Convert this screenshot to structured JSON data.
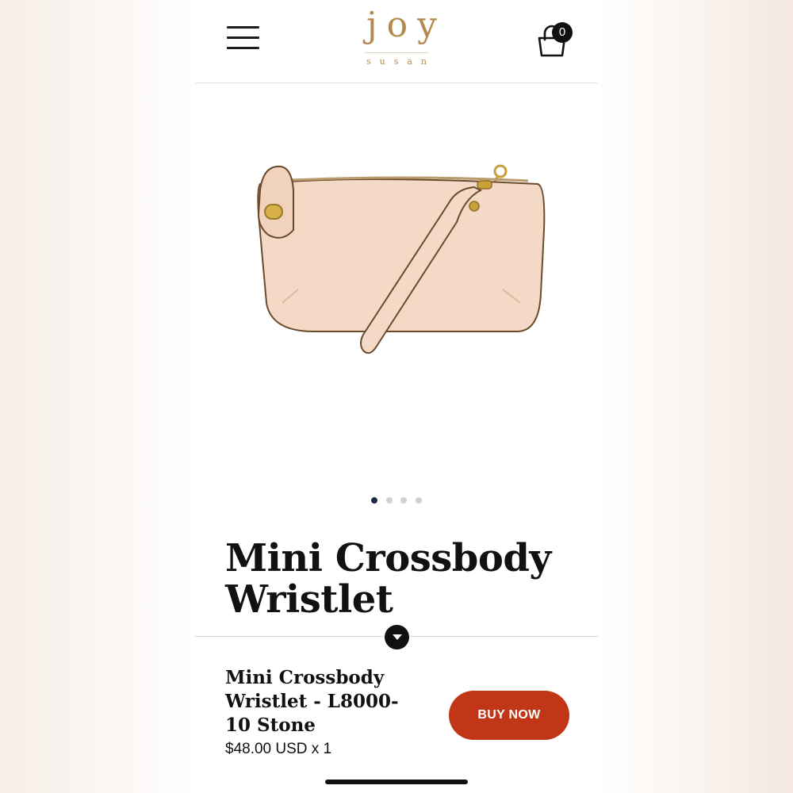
{
  "header": {
    "logo_main": "joy",
    "logo_sub": "susan",
    "cart_count": "0",
    "menu_icon": "hamburger-icon",
    "cart_icon": "shopping-bag-icon"
  },
  "carousel": {
    "slides": 4,
    "active_index": 0
  },
  "product": {
    "title": "Mini Crossbody Wristlet",
    "image_subject": "pink leather wristlet clutch with gold hardware"
  },
  "sticky_bar": {
    "name": "Mini Crossbody Wristlet - L8000-10 Stone",
    "price": "$48.00 USD x 1",
    "buy_label": "BUY NOW"
  },
  "colors": {
    "accent": "#c13616",
    "logo": "#b38b50",
    "dot_active": "#1d2a44",
    "dot_inactive": "#cfd2d6"
  }
}
